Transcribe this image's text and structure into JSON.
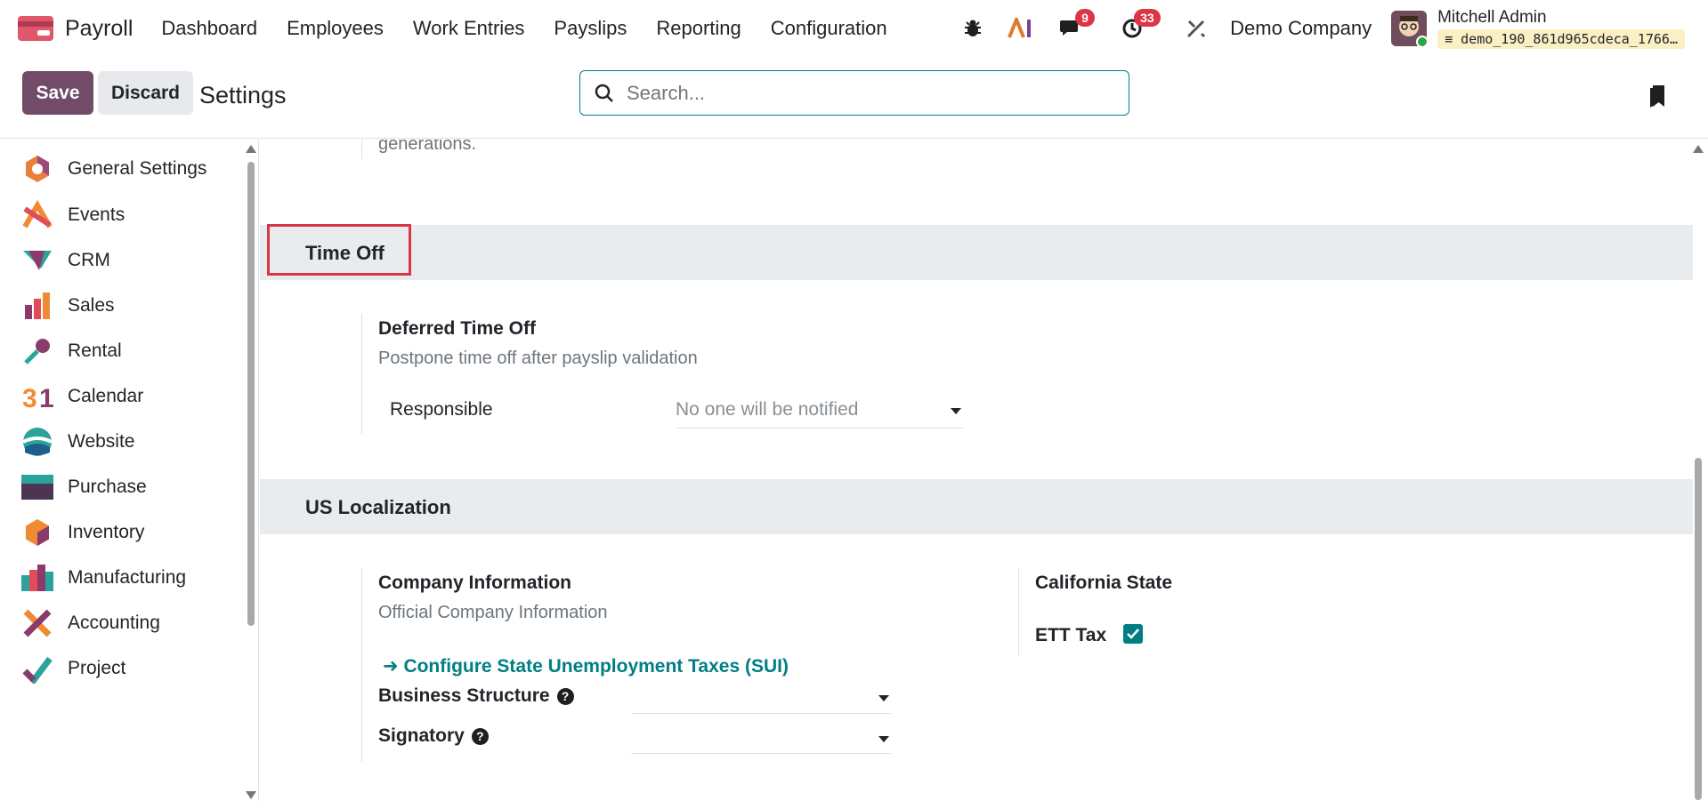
{
  "app": {
    "name": "Payroll"
  },
  "menu": [
    {
      "label": "Dashboard"
    },
    {
      "label": "Employees"
    },
    {
      "label": "Work Entries"
    },
    {
      "label": "Payslips"
    },
    {
      "label": "Reporting"
    },
    {
      "label": "Configuration"
    }
  ],
  "systray": {
    "messages_count": "9",
    "activities_count": "33",
    "company": "Demo Company",
    "user_name": "Mitchell Admin",
    "database": "demo_190_861d965cdeca_1766…"
  },
  "control_panel": {
    "save_label": "Save",
    "discard_label": "Discard",
    "title": "Settings",
    "search_placeholder": "Search..."
  },
  "sidebar": {
    "items": [
      {
        "label": "General Settings",
        "icon": "general-settings-icon"
      },
      {
        "label": "Events",
        "icon": "events-icon"
      },
      {
        "label": "CRM",
        "icon": "crm-icon"
      },
      {
        "label": "Sales",
        "icon": "sales-icon"
      },
      {
        "label": "Rental",
        "icon": "rental-icon"
      },
      {
        "label": "Calendar",
        "icon": "calendar-icon"
      },
      {
        "label": "Website",
        "icon": "website-icon"
      },
      {
        "label": "Purchase",
        "icon": "purchase-icon"
      },
      {
        "label": "Inventory",
        "icon": "inventory-icon"
      },
      {
        "label": "Manufacturing",
        "icon": "manufacturing-icon"
      },
      {
        "label": "Accounting",
        "icon": "accounting-icon"
      },
      {
        "label": "Project",
        "icon": "project-icon"
      }
    ]
  },
  "content": {
    "top_fragment": "generations.",
    "time_off": {
      "section_title": "Time Off",
      "setting_title": "Deferred Time Off",
      "setting_desc": "Postpone time off after payslip validation",
      "responsible_label": "Responsible",
      "responsible_placeholder": "No one will be notified"
    },
    "us_localization": {
      "section_title": "US Localization",
      "company_info_title": "Company Information",
      "company_info_desc": "Official Company Information",
      "sui_link": "Configure State Unemployment Taxes (SUI)",
      "business_structure_label": "Business Structure",
      "signatory_label": "Signatory",
      "california_title": "California State",
      "ett_tax_label": "ETT Tax",
      "ett_tax_checked": true
    }
  },
  "colors": {
    "brand": "#714b67",
    "accent": "#017e84",
    "badge": "#dc3545",
    "highlight_box": "#dc3545"
  }
}
